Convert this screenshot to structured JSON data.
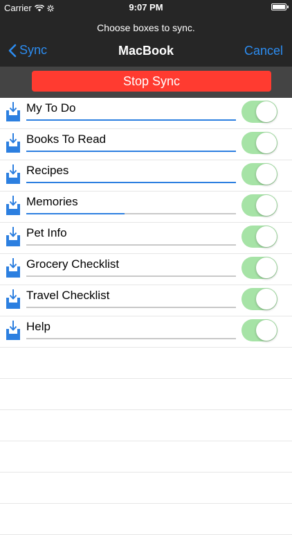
{
  "status": {
    "carrier": "Carrier",
    "time": "9:07 PM"
  },
  "header": {
    "prompt": "Choose boxes to sync.",
    "back_label": "Sync",
    "title": "MacBook",
    "cancel_label": "Cancel"
  },
  "stop_button": "Stop Sync",
  "colors": {
    "accent": "#2c8cf0",
    "stop": "#ff3b30",
    "toggle_on": "#a6e3a6",
    "progress": "#2c7fe0"
  },
  "boxes": [
    {
      "name": "My To Do",
      "progress": 1.0,
      "enabled": true
    },
    {
      "name": "Books To Read",
      "progress": 1.0,
      "enabled": true
    },
    {
      "name": "Recipes",
      "progress": 1.0,
      "enabled": true
    },
    {
      "name": "Memories",
      "progress": 0.47,
      "enabled": true
    },
    {
      "name": "Pet Info",
      "progress": 0.0,
      "enabled": true
    },
    {
      "name": "Grocery Checklist",
      "progress": 0.0,
      "enabled": true
    },
    {
      "name": "Travel Checklist",
      "progress": 0.0,
      "enabled": true
    },
    {
      "name": "Help",
      "progress": 0.0,
      "enabled": true
    }
  ]
}
